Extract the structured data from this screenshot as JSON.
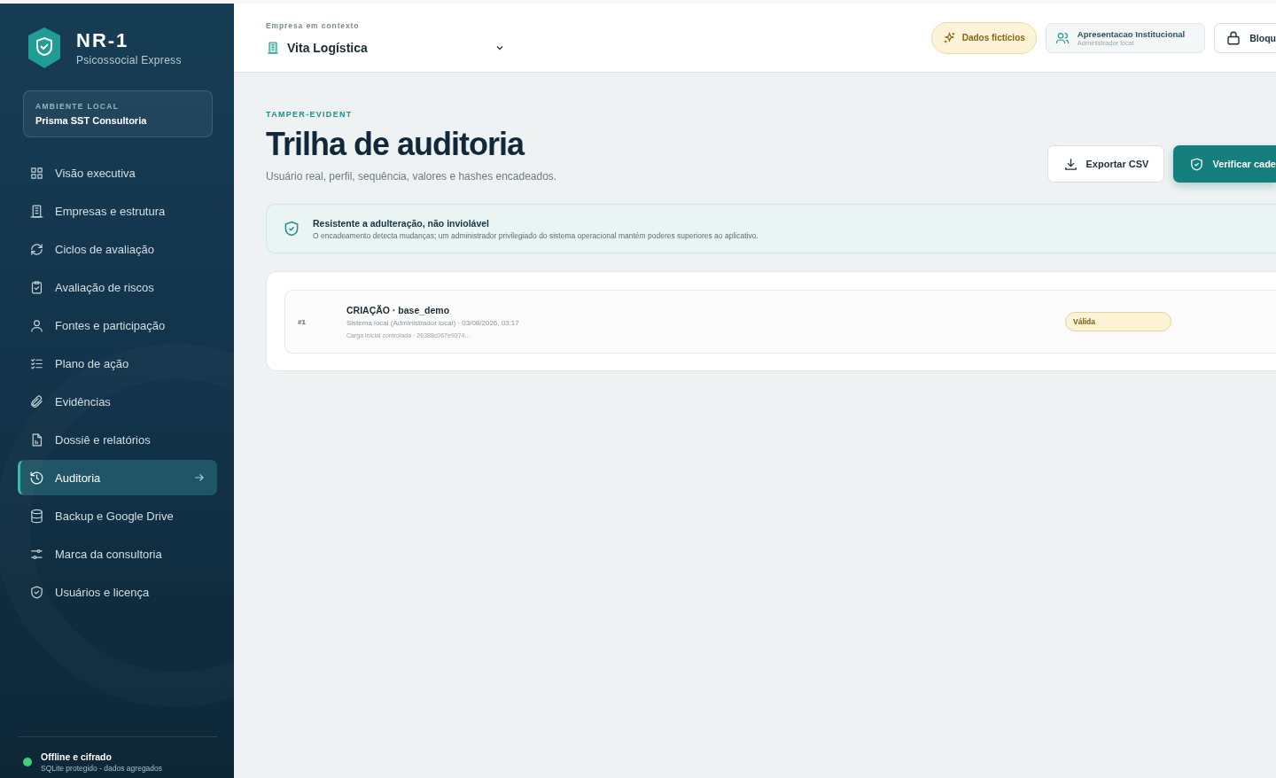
{
  "brand": {
    "title": "NR-1",
    "subtitle": "Psicossocial Express"
  },
  "environment": {
    "label": "AMBIENTE LOCAL",
    "name": "Prisma SST Consultoria"
  },
  "nav": [
    {
      "label": "Visão executiva",
      "selected": false
    },
    {
      "label": "Empresas e estrutura",
      "selected": false
    },
    {
      "label": "Ciclos de avaliação",
      "selected": false
    },
    {
      "label": "Avaliação de riscos",
      "selected": false
    },
    {
      "label": "Fontes e participação",
      "selected": false
    },
    {
      "label": "Plano de ação",
      "selected": false
    },
    {
      "label": "Evidências",
      "selected": false
    },
    {
      "label": "Dossiê e relatórios",
      "selected": false
    },
    {
      "label": "Auditoria",
      "selected": true
    },
    {
      "label": "Backup e Google Drive",
      "selected": false
    },
    {
      "label": "Marca da consultoria",
      "selected": false
    },
    {
      "label": "Usuários e licença",
      "selected": false
    }
  ],
  "status": {
    "title": "Offline e cifrado",
    "detail": "SQLite protegido - dados agregados",
    "color": "#3ecf7a"
  },
  "topbar": {
    "context_label": "Empresa em contexto",
    "company": "Vita Logística",
    "demo_badge": "Dados fictícios",
    "user_name": "Apresentacao Institucional",
    "user_role": "Administrador local",
    "lock_button": "Bloqu"
  },
  "page": {
    "eyebrow": "TAMPER-EVIDENT",
    "title": "Trilha de auditoria",
    "subtitle": "Usuário real, perfil, sequência, valores e hashes encadeados.",
    "buttons": [
      {
        "label": "Exportar CSV",
        "kind": "secondary"
      },
      {
        "label": "Verificar cade",
        "kind": "primary"
      }
    ]
  },
  "notice": {
    "title": "Resistente a adulteração, não inviolável",
    "text": "O encadeamento detecta mudanças; um administrador privilegiado do sistema operacional mantém poderes superiores ao aplicativo."
  },
  "entries": [
    {
      "seq": "#1",
      "title": "CRIAÇÃO · base_demo",
      "meta": "Sistema local (Administrador local) · 03/08/2026, 03:17",
      "detail": "Carga inicial controlada · 26388c067e9374...",
      "status": "Válida",
      "valid": true
    }
  ]
}
